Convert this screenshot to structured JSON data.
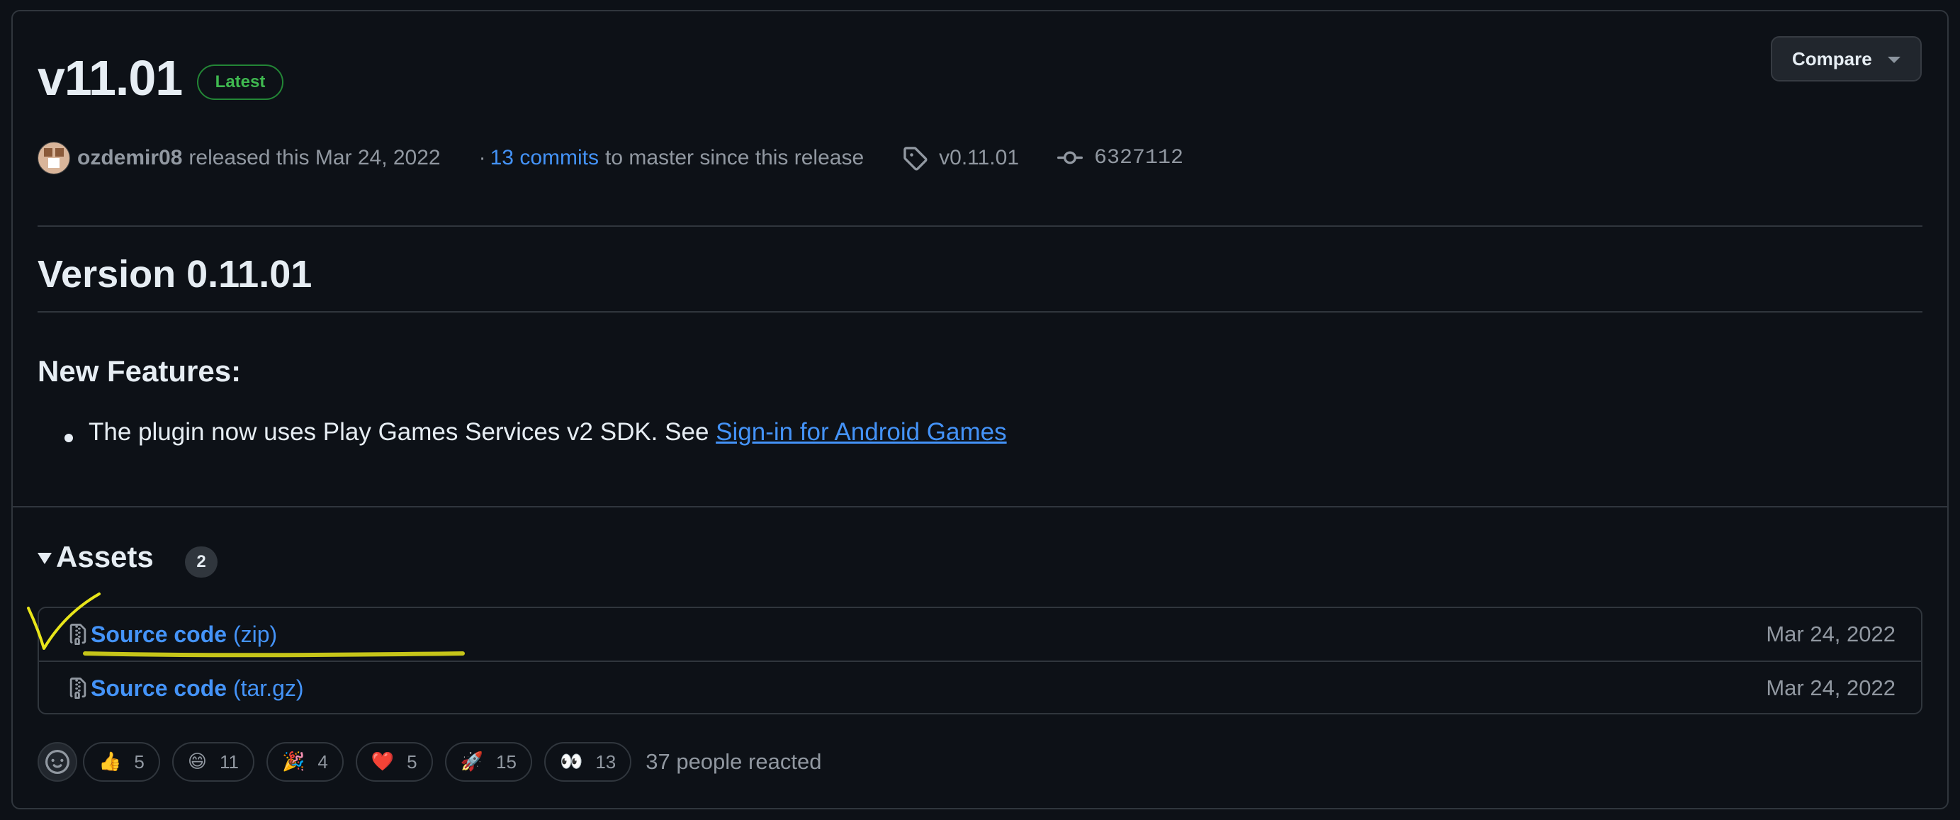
{
  "release": {
    "title": "v11.01",
    "badge": "Latest",
    "compare_label": "Compare",
    "author": "ozdemir08",
    "released_text": "released this Mar 24, 2022",
    "commits_prefix": "·",
    "commits_link": "13 commits",
    "commits_suffix": "to master since this release",
    "tag": "v0.11.01",
    "commit_hash": "6327112"
  },
  "body": {
    "heading": "Version 0.11.01",
    "subheading": "New Features:",
    "bullet_text": "The plugin now uses Play Games Services v2 SDK. See ",
    "bullet_link": "Sign-in for Android Games"
  },
  "assets": {
    "label": "Assets",
    "count": "2",
    "items": [
      {
        "name": "Source code",
        "ext": "(zip)",
        "date": "Mar 24, 2022"
      },
      {
        "name": "Source code",
        "ext": "(tar.gz)",
        "date": "Mar 24, 2022"
      }
    ]
  },
  "reactions": {
    "items": [
      {
        "emoji": "👍",
        "icon": "thumbs-up",
        "count": "5"
      },
      {
        "emoji": "😄",
        "icon": "laugh",
        "count": "11"
      },
      {
        "emoji": "🎉",
        "icon": "hooray",
        "count": "4"
      },
      {
        "emoji": "❤️",
        "icon": "heart",
        "count": "5"
      },
      {
        "emoji": "🚀",
        "icon": "rocket",
        "count": "15"
      },
      {
        "emoji": "👀",
        "icon": "eyes",
        "count": "13"
      }
    ],
    "summary": "37 people reacted"
  },
  "colors": {
    "background": "#0d1117",
    "link": "#4493f8",
    "latest_green": "#3fb950",
    "annotation_yellow": "#e8e51a"
  }
}
